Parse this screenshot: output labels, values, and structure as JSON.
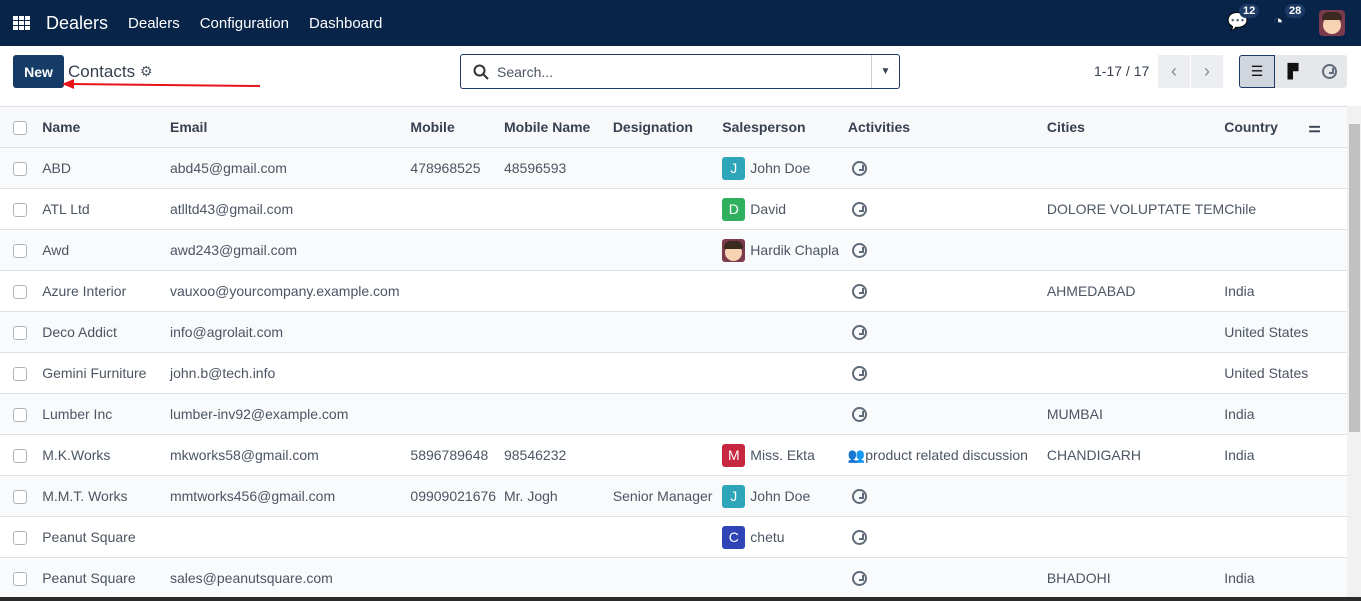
{
  "nav": {
    "brand": "Dealers",
    "menu": [
      "Dealers",
      "Configuration",
      "Dashboard"
    ],
    "messages_count": "12",
    "activities_count": "28"
  },
  "control": {
    "new_label": "New",
    "title": "Contacts",
    "search_placeholder": "Search...",
    "pager": "1-17 / 17"
  },
  "columns": [
    "Name",
    "Email",
    "Mobile",
    "Mobile Name",
    "Designation",
    "Salesperson",
    "Activities",
    "Cities",
    "Country"
  ],
  "rows": [
    {
      "name": "ABD",
      "email": "abd45@gmail.com",
      "mobile": "478968525",
      "mobile_name": "48596593",
      "designation": "",
      "salesperson": "John Doe",
      "initial": "J",
      "color": "#2ea5b8",
      "activity": "",
      "city": "",
      "country": ""
    },
    {
      "name": "ATL Ltd",
      "email": "atlltd43@gmail.com",
      "mobile": "",
      "mobile_name": "",
      "designation": "",
      "salesperson": "David",
      "initial": "D",
      "color": "#2fb05f",
      "activity": "",
      "city": "DOLORE VOLUPTATE TEM",
      "country": "Chile"
    },
    {
      "name": "Awd",
      "email": "awd243@gmail.com",
      "mobile": "",
      "mobile_name": "",
      "designation": "",
      "salesperson": "Hardik Chapla",
      "initial": "",
      "color": "photo",
      "activity": "",
      "city": "",
      "country": ""
    },
    {
      "name": "Azure Interior",
      "email": "vauxoo@yourcompany.example.com",
      "mobile": "",
      "mobile_name": "",
      "designation": "",
      "salesperson": "",
      "initial": "",
      "color": "",
      "activity": "",
      "city": "AHMEDABAD",
      "country": "India"
    },
    {
      "name": "Deco Addict",
      "email": "info@agrolait.com",
      "mobile": "",
      "mobile_name": "",
      "designation": "",
      "salesperson": "",
      "initial": "",
      "color": "",
      "activity": "",
      "city": "",
      "country": "United States"
    },
    {
      "name": "Gemini Furniture",
      "email": "john.b@tech.info",
      "mobile": "",
      "mobile_name": "",
      "designation": "",
      "salesperson": "",
      "initial": "",
      "color": "",
      "activity": "",
      "city": "",
      "country": "United States"
    },
    {
      "name": "Lumber Inc",
      "email": "lumber-inv92@example.com",
      "mobile": "",
      "mobile_name": "",
      "designation": "",
      "salesperson": "",
      "initial": "",
      "color": "",
      "activity": "",
      "city": "MUMBAI",
      "country": "India"
    },
    {
      "name": "M.K.Works",
      "email": "mkworks58@gmail.com",
      "mobile": "5896789648",
      "mobile_name": "98546232",
      "designation": "",
      "salesperson": "Miss. Ekta",
      "initial": "M",
      "color": "#c8283f",
      "activity": "product related discussion",
      "city": "CHANDIGARH",
      "country": "India"
    },
    {
      "name": "M.M.T. Works",
      "email": "mmtworks456@gmail.com",
      "mobile": "09909021676",
      "mobile_name": "Mr. Jogh",
      "designation": "Senior Manager",
      "salesperson": "John Doe",
      "initial": "J",
      "color": "#2ea5b8",
      "activity": "",
      "city": "",
      "country": ""
    },
    {
      "name": "Peanut Square",
      "email": "",
      "mobile": "",
      "mobile_name": "",
      "designation": "",
      "salesperson": "chetu",
      "initial": "C",
      "color": "#2f45b5",
      "activity": "",
      "city": "",
      "country": ""
    },
    {
      "name": "Peanut Square",
      "email": "sales@peanutsquare.com",
      "mobile": "",
      "mobile_name": "",
      "designation": "",
      "salesperson": "",
      "initial": "",
      "color": "",
      "activity": "",
      "city": "BHADOHI",
      "country": "India"
    }
  ]
}
